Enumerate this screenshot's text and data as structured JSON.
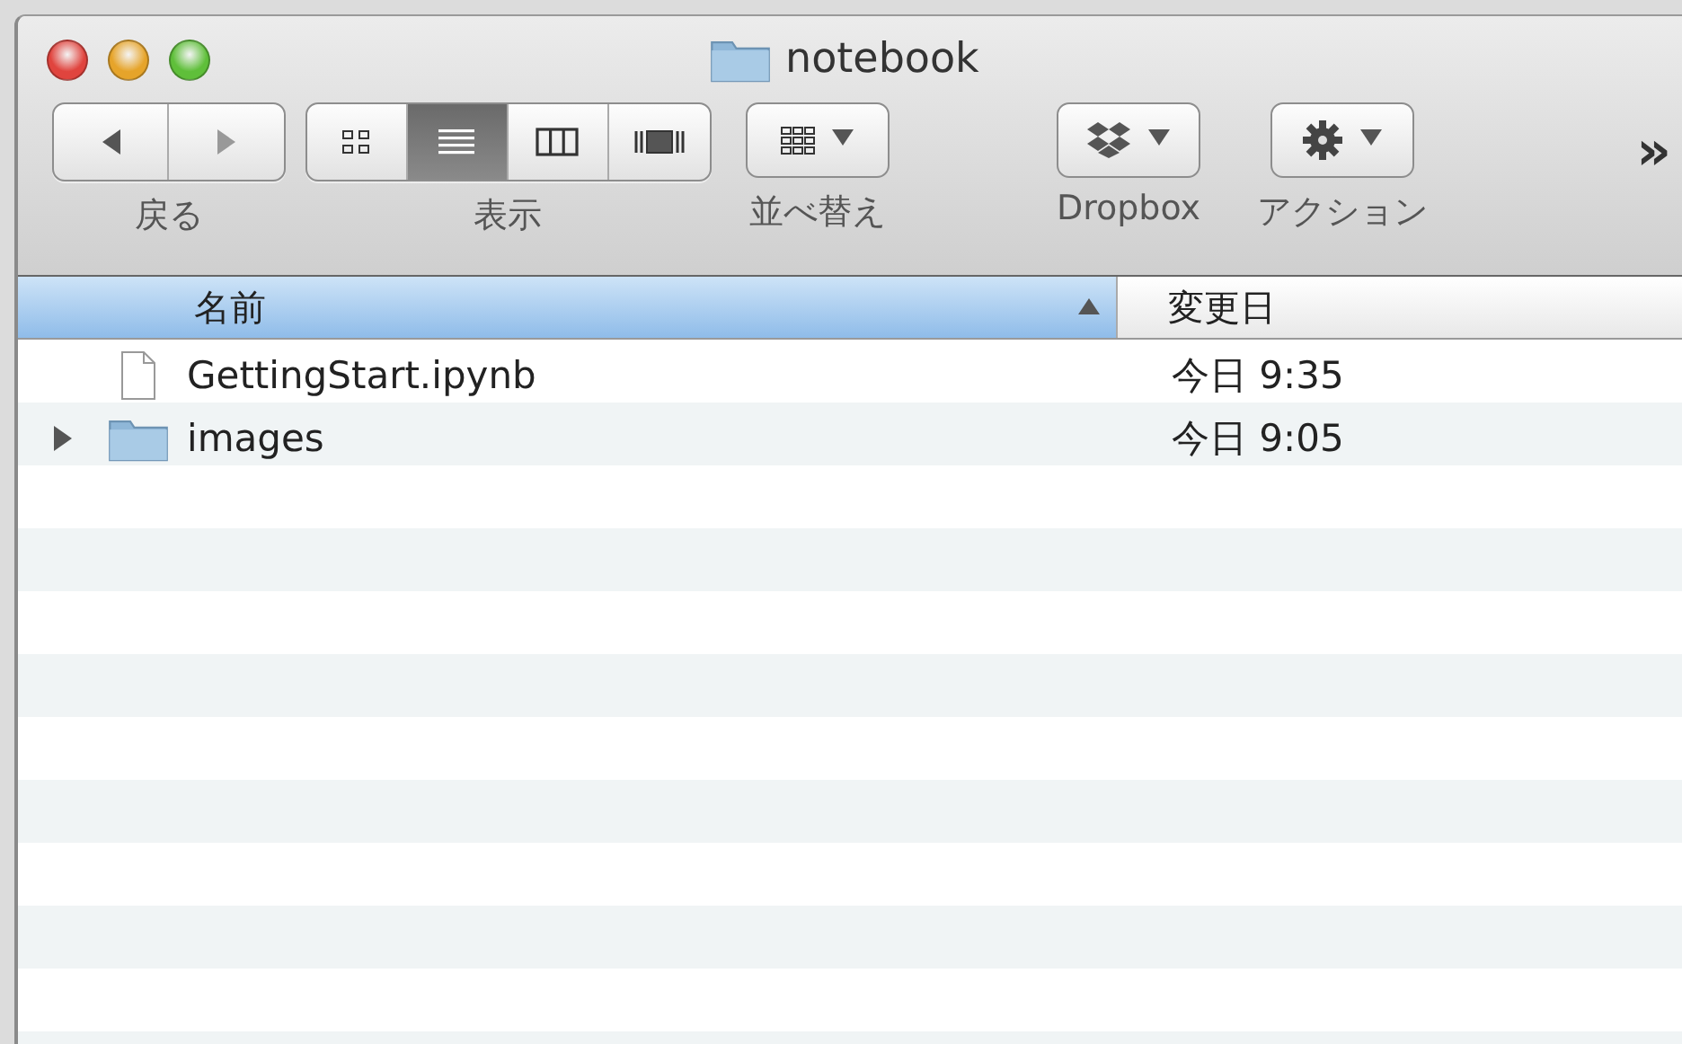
{
  "window": {
    "title": "notebook"
  },
  "toolbar": {
    "nav": {
      "label": "戻る",
      "back_disabled": false,
      "forward_disabled": true
    },
    "view": {
      "label": "表示",
      "segments": [
        {
          "kind": "icons",
          "selected": false
        },
        {
          "kind": "list",
          "selected": true
        },
        {
          "kind": "columns",
          "selected": false
        },
        {
          "kind": "coverflow",
          "selected": false
        }
      ]
    },
    "arrange": {
      "label": "並べ替え"
    },
    "dropbox": {
      "label": "Dropbox"
    },
    "action": {
      "label": "アクション"
    },
    "overflow": "»"
  },
  "table": {
    "columns": [
      {
        "label": "名前",
        "sorted": true
      },
      {
        "label": "変更日",
        "sorted": false
      }
    ],
    "rows": [
      {
        "kind": "file",
        "name": "GettingStart.ipynb",
        "modified": "今日 9:35"
      },
      {
        "kind": "folder",
        "name": "images",
        "modified": "今日 9:05",
        "expanded": false
      }
    ]
  }
}
